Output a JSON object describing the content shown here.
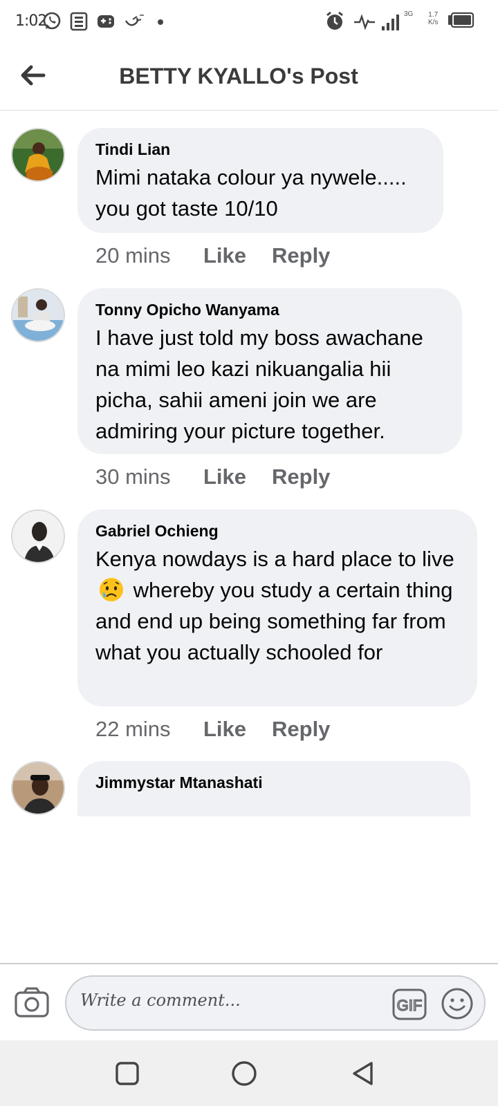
{
  "status_bar": {
    "time": "1:02",
    "network_type": "3G",
    "speed_value": "1.7",
    "speed_unit": "K/s",
    "icons": [
      "whatsapp-icon",
      "news-icon",
      "gamepad-icon",
      "app-icon",
      "alarm-icon",
      "activity-icon",
      "signal-icon",
      "battery-icon"
    ]
  },
  "header": {
    "title": "BETTY KYALLO's Post",
    "back_icon": "arrow-left-icon"
  },
  "comments": [
    {
      "author": "Tindi Lian",
      "text": "Mimi nataka colour ya nywele..... you got taste 10/10",
      "time": "20 mins",
      "like": "Like",
      "reply": "Reply"
    },
    {
      "author": "Tonny Opicho Wanyama",
      "text": "I have just told my boss awachane na mimi leo kazi nikuangalia hii picha, sahii ameni join we are admiring your picture together.",
      "time": "30 mins",
      "like": "Like",
      "reply": "Reply"
    },
    {
      "author": "Gabriel Ochieng",
      "text_before_emoji": "Kenya nowdays is a hard place to live",
      "emoji": "sad-sweat-face",
      "text_after_emoji": "whereby you study a certain thing and end up being something far from what you actually schooled for",
      "time": "22 mins",
      "like": "Like",
      "reply": "Reply"
    },
    {
      "author": "Jimmystar Mtanashati"
    }
  ],
  "composer": {
    "placeholder": "Write a comment...",
    "gif_label": "GIF"
  },
  "colors": {
    "bubble": "#eff1f4",
    "meta_text": "#65676b",
    "title_text": "#3a3b3c"
  }
}
